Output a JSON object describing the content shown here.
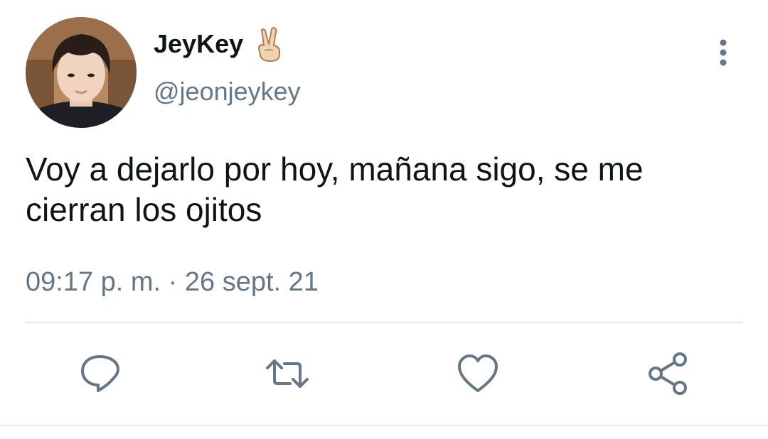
{
  "user": {
    "display_name": "JeyKey",
    "name_emoji": "victory-hand-emoji",
    "handle": "@jeonjeykey",
    "avatar": "profile-photo"
  },
  "tweet": {
    "text_line1": "Voy a dejarlo por hoy, mañana sigo, se me",
    "text_line2": "cierran los ojitos",
    "timestamp": "09:17 p. m. · 26 sept. 21"
  },
  "actions": [
    {
      "name": "reply",
      "icon": "speech-bubble-icon"
    },
    {
      "name": "retweet",
      "icon": "retweet-icon"
    },
    {
      "name": "like",
      "icon": "heart-icon"
    },
    {
      "name": "share",
      "icon": "share-icon"
    }
  ],
  "colors": {
    "text_primary": "#0f1419",
    "text_secondary": "#657786",
    "icon_gray": "#657786",
    "divider": "#e1e8ed"
  }
}
